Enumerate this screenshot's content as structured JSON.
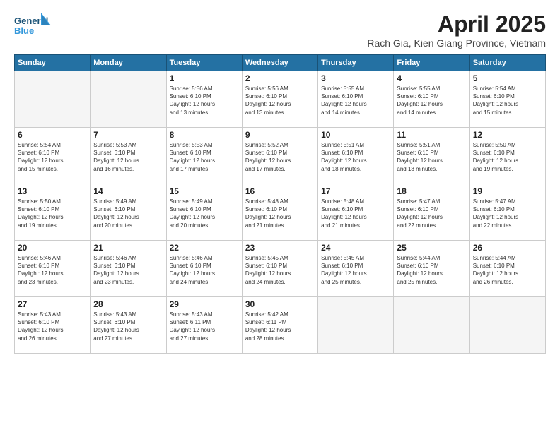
{
  "logo": {
    "line1": "General",
    "line2": "Blue"
  },
  "title": "April 2025",
  "subtitle": "Rach Gia, Kien Giang Province, Vietnam",
  "days_of_week": [
    "Sunday",
    "Monday",
    "Tuesday",
    "Wednesday",
    "Thursday",
    "Friday",
    "Saturday"
  ],
  "weeks": [
    [
      {
        "day": "",
        "info": ""
      },
      {
        "day": "",
        "info": ""
      },
      {
        "day": "1",
        "info": "Sunrise: 5:56 AM\nSunset: 6:10 PM\nDaylight: 12 hours\nand 13 minutes."
      },
      {
        "day": "2",
        "info": "Sunrise: 5:56 AM\nSunset: 6:10 PM\nDaylight: 12 hours\nand 13 minutes."
      },
      {
        "day": "3",
        "info": "Sunrise: 5:55 AM\nSunset: 6:10 PM\nDaylight: 12 hours\nand 14 minutes."
      },
      {
        "day": "4",
        "info": "Sunrise: 5:55 AM\nSunset: 6:10 PM\nDaylight: 12 hours\nand 14 minutes."
      },
      {
        "day": "5",
        "info": "Sunrise: 5:54 AM\nSunset: 6:10 PM\nDaylight: 12 hours\nand 15 minutes."
      }
    ],
    [
      {
        "day": "6",
        "info": "Sunrise: 5:54 AM\nSunset: 6:10 PM\nDaylight: 12 hours\nand 15 minutes."
      },
      {
        "day": "7",
        "info": "Sunrise: 5:53 AM\nSunset: 6:10 PM\nDaylight: 12 hours\nand 16 minutes."
      },
      {
        "day": "8",
        "info": "Sunrise: 5:53 AM\nSunset: 6:10 PM\nDaylight: 12 hours\nand 17 minutes."
      },
      {
        "day": "9",
        "info": "Sunrise: 5:52 AM\nSunset: 6:10 PM\nDaylight: 12 hours\nand 17 minutes."
      },
      {
        "day": "10",
        "info": "Sunrise: 5:51 AM\nSunset: 6:10 PM\nDaylight: 12 hours\nand 18 minutes."
      },
      {
        "day": "11",
        "info": "Sunrise: 5:51 AM\nSunset: 6:10 PM\nDaylight: 12 hours\nand 18 minutes."
      },
      {
        "day": "12",
        "info": "Sunrise: 5:50 AM\nSunset: 6:10 PM\nDaylight: 12 hours\nand 19 minutes."
      }
    ],
    [
      {
        "day": "13",
        "info": "Sunrise: 5:50 AM\nSunset: 6:10 PM\nDaylight: 12 hours\nand 19 minutes."
      },
      {
        "day": "14",
        "info": "Sunrise: 5:49 AM\nSunset: 6:10 PM\nDaylight: 12 hours\nand 20 minutes."
      },
      {
        "day": "15",
        "info": "Sunrise: 5:49 AM\nSunset: 6:10 PM\nDaylight: 12 hours\nand 20 minutes."
      },
      {
        "day": "16",
        "info": "Sunrise: 5:48 AM\nSunset: 6:10 PM\nDaylight: 12 hours\nand 21 minutes."
      },
      {
        "day": "17",
        "info": "Sunrise: 5:48 AM\nSunset: 6:10 PM\nDaylight: 12 hours\nand 21 minutes."
      },
      {
        "day": "18",
        "info": "Sunrise: 5:47 AM\nSunset: 6:10 PM\nDaylight: 12 hours\nand 22 minutes."
      },
      {
        "day": "19",
        "info": "Sunrise: 5:47 AM\nSunset: 6:10 PM\nDaylight: 12 hours\nand 22 minutes."
      }
    ],
    [
      {
        "day": "20",
        "info": "Sunrise: 5:46 AM\nSunset: 6:10 PM\nDaylight: 12 hours\nand 23 minutes."
      },
      {
        "day": "21",
        "info": "Sunrise: 5:46 AM\nSunset: 6:10 PM\nDaylight: 12 hours\nand 23 minutes."
      },
      {
        "day": "22",
        "info": "Sunrise: 5:46 AM\nSunset: 6:10 PM\nDaylight: 12 hours\nand 24 minutes."
      },
      {
        "day": "23",
        "info": "Sunrise: 5:45 AM\nSunset: 6:10 PM\nDaylight: 12 hours\nand 24 minutes."
      },
      {
        "day": "24",
        "info": "Sunrise: 5:45 AM\nSunset: 6:10 PM\nDaylight: 12 hours\nand 25 minutes."
      },
      {
        "day": "25",
        "info": "Sunrise: 5:44 AM\nSunset: 6:10 PM\nDaylight: 12 hours\nand 25 minutes."
      },
      {
        "day": "26",
        "info": "Sunrise: 5:44 AM\nSunset: 6:10 PM\nDaylight: 12 hours\nand 26 minutes."
      }
    ],
    [
      {
        "day": "27",
        "info": "Sunrise: 5:43 AM\nSunset: 6:10 PM\nDaylight: 12 hours\nand 26 minutes."
      },
      {
        "day": "28",
        "info": "Sunrise: 5:43 AM\nSunset: 6:10 PM\nDaylight: 12 hours\nand 27 minutes."
      },
      {
        "day": "29",
        "info": "Sunrise: 5:43 AM\nSunset: 6:11 PM\nDaylight: 12 hours\nand 27 minutes."
      },
      {
        "day": "30",
        "info": "Sunrise: 5:42 AM\nSunset: 6:11 PM\nDaylight: 12 hours\nand 28 minutes."
      },
      {
        "day": "",
        "info": ""
      },
      {
        "day": "",
        "info": ""
      },
      {
        "day": "",
        "info": ""
      }
    ]
  ]
}
